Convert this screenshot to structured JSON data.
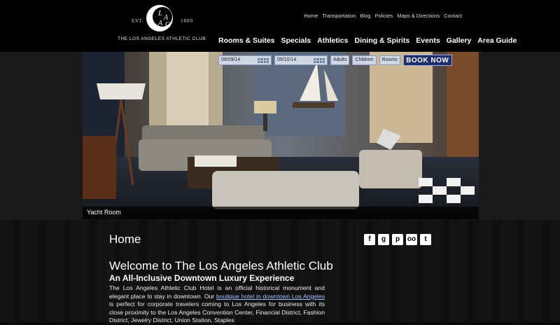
{
  "logo": {
    "est": "EST.",
    "year": "1880",
    "monogram": "LAAC",
    "club_name": "THE LOS ANGELES ATHLETIC CLUB"
  },
  "top_links": [
    "Home",
    "Transportation",
    "Blog",
    "Policies",
    "Maps & Directions",
    "Contact"
  ],
  "main_nav": [
    "Rooms & Suites",
    "Specials",
    "Athletics",
    "Dining & Spirits",
    "Events",
    "Gallery",
    "Area Guide"
  ],
  "booking": {
    "checkin": "09/09/14",
    "checkout": "09/10/14",
    "adults": "Adults",
    "children": "Children",
    "rooms": "Rooms",
    "book_label": "BOOK NOW"
  },
  "hero": {
    "caption": "Yacht Room"
  },
  "social": [
    {
      "icon": "facebook-icon",
      "glyph": "f"
    },
    {
      "icon": "google-plus-icon",
      "glyph": "g"
    },
    {
      "icon": "pinterest-icon",
      "glyph": "p"
    },
    {
      "icon": "tripadvisor-icon",
      "glyph": "oo"
    },
    {
      "icon": "twitter-icon",
      "glyph": "t"
    }
  ],
  "content": {
    "page_title": "Home",
    "welcome": "Welcome to The Los Angeles Athletic Club",
    "subhead": "An All-Inclusive Downtown Luxury Experience",
    "p1": "The Los Angeles Athletic Club Hotel is an official historical monument and elegant place to stay in downtown. Our ",
    "link": "boutique hotel in downtown Los Angeles",
    "p2": " is perfect for corporate travelers coming to Los Angeles for business with its close proximity to the Los Angeles Convention Center, Financial District, Fashion District, Jewelry District, Union Station, Staples"
  }
}
